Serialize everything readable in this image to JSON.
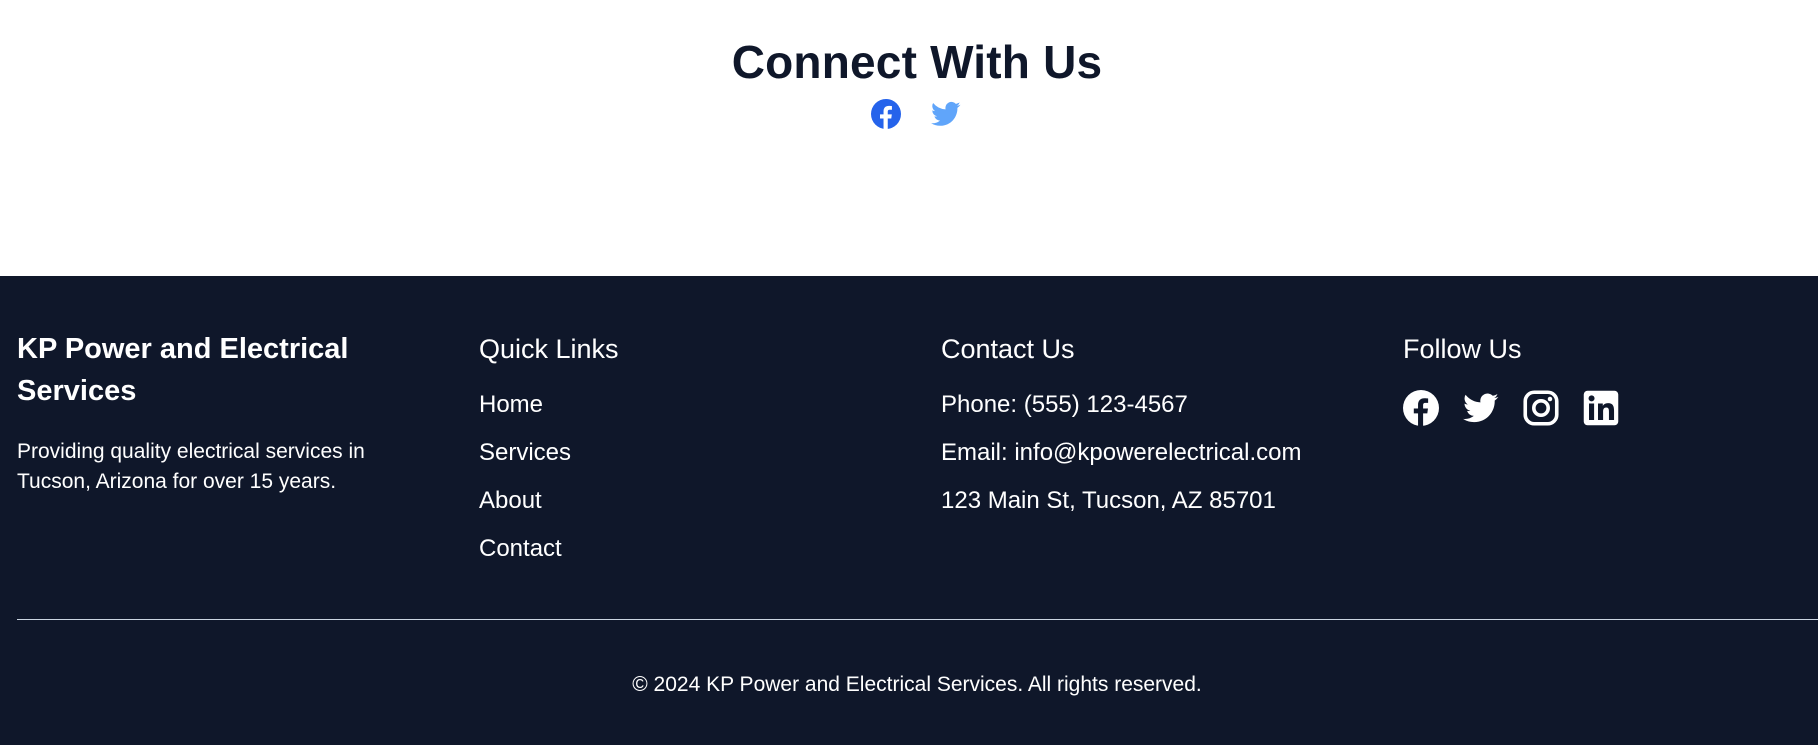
{
  "connect": {
    "title": "Connect With Us",
    "icons": [
      {
        "name": "facebook-icon",
        "color": "#2563eb"
      },
      {
        "name": "twitter-icon",
        "color": "#60a5fa"
      }
    ]
  },
  "footer": {
    "brand": {
      "title": "KP Power and Electrical Services",
      "description": "Providing quality electrical services in Tucson, Arizona for over 15 years."
    },
    "quick_links": {
      "heading": "Quick Links",
      "items": [
        "Home",
        "Services",
        "About",
        "Contact"
      ]
    },
    "contact": {
      "heading": "Contact Us",
      "phone": "Phone: (555) 123-4567",
      "email": "Email: info@kpowerelectrical.com",
      "address": "123 Main St, Tucson, AZ 85701"
    },
    "follow": {
      "heading": "Follow Us",
      "icons": [
        "facebook-icon",
        "twitter-icon",
        "instagram-icon",
        "linkedin-icon"
      ]
    },
    "copyright": "© 2024 KP Power and Electrical Services. All rights reserved."
  },
  "colors": {
    "footer_bg": "#0f172a",
    "title_text": "#0f172a",
    "facebook_blue": "#2563eb",
    "twitter_blue": "#60a5fa"
  }
}
